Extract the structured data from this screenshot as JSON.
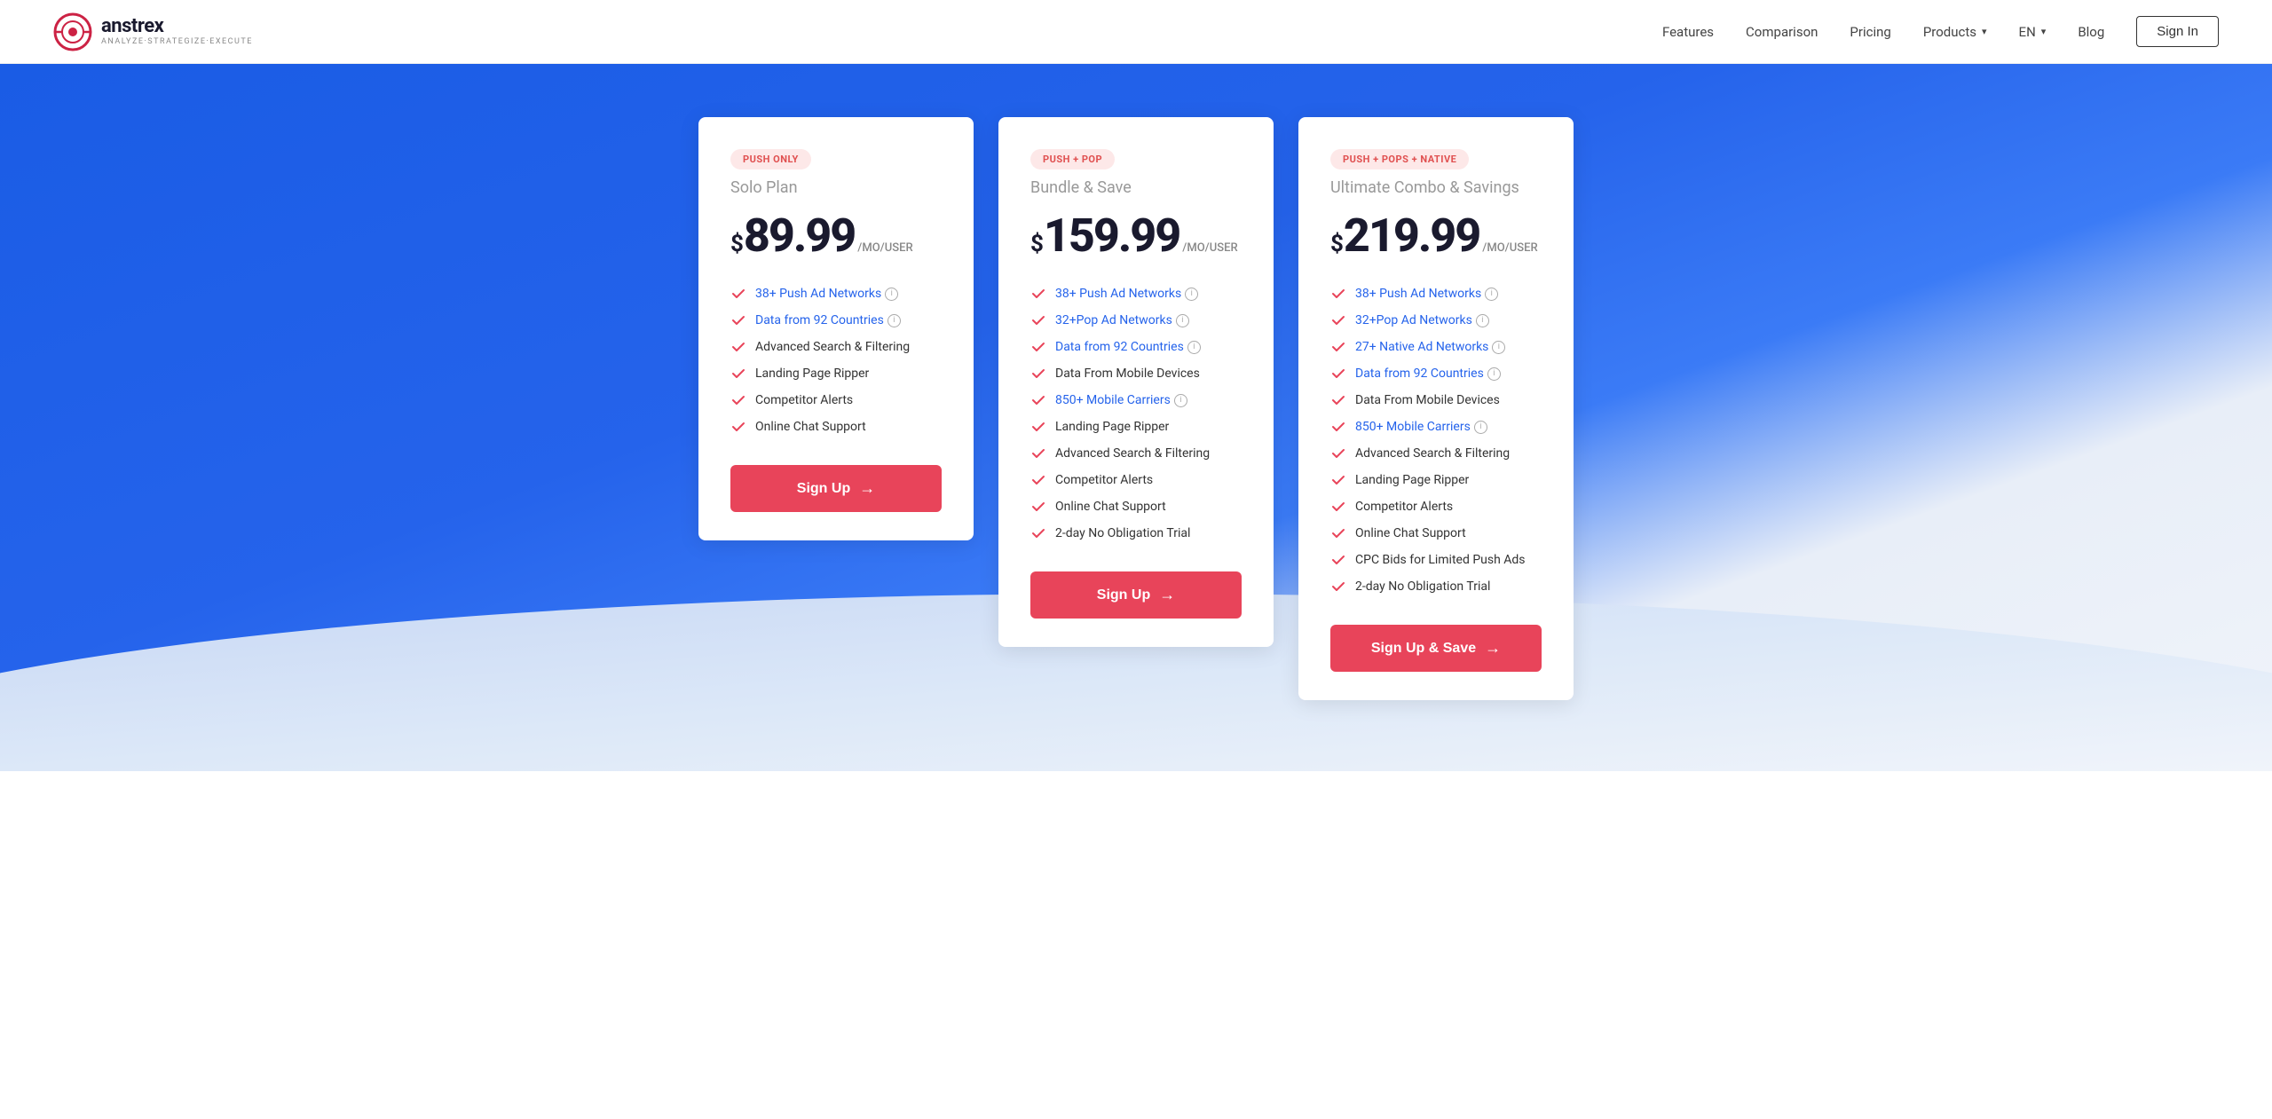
{
  "header": {
    "logo": {
      "main": "anstrex",
      "sub": "Analyze·Strategize·Execute"
    },
    "nav": {
      "features": "Features",
      "comparison": "Comparison",
      "pricing": "Pricing",
      "products": "Products",
      "lang": "EN",
      "blog": "Blog",
      "signin": "Sign In"
    }
  },
  "plans": [
    {
      "badge": "PUSH ONLY",
      "badge_class": "badge-push",
      "name": "Solo Plan",
      "price_dollar": "$",
      "price": "89.99",
      "price_unit": "/MO/USER",
      "features": [
        {
          "text": "38+ Push Ad Networks",
          "link": true,
          "info": true
        },
        {
          "text": "Data from 92 Countries",
          "link": true,
          "info": true
        },
        {
          "text": "Advanced Search & Filtering",
          "link": false,
          "info": false
        },
        {
          "text": "Landing Page Ripper",
          "link": false,
          "info": false
        },
        {
          "text": "Competitor Alerts",
          "link": false,
          "info": false
        },
        {
          "text": "Online Chat Support",
          "link": false,
          "info": false
        }
      ],
      "cta": "Sign Up",
      "cta_key": "plans.0.cta"
    },
    {
      "badge": "PUSH + POP",
      "badge_class": "badge-push-pop",
      "name": "Bundle & Save",
      "price_dollar": "$",
      "price": "159.99",
      "price_unit": "/MO/USER",
      "features": [
        {
          "text": "38+ Push Ad Networks",
          "link": true,
          "info": true
        },
        {
          "text": "32+Pop Ad Networks",
          "link": true,
          "info": true
        },
        {
          "text": "Data from 92 Countries",
          "link": true,
          "info": true
        },
        {
          "text": "Data From Mobile Devices",
          "link": false,
          "info": false
        },
        {
          "text": "850+ Mobile Carriers",
          "link": true,
          "info": true
        },
        {
          "text": "Landing Page Ripper",
          "link": false,
          "info": false
        },
        {
          "text": "Advanced Search & Filtering",
          "link": false,
          "info": false
        },
        {
          "text": "Competitor Alerts",
          "link": false,
          "info": false
        },
        {
          "text": "Online Chat Support",
          "link": false,
          "info": false
        },
        {
          "text": "2-day No Obligation Trial",
          "link": false,
          "info": false
        }
      ],
      "cta": "Sign Up",
      "cta_key": "plans.1.cta"
    },
    {
      "badge": "PUSH + POPS + NATIVE",
      "badge_class": "badge-ultimate",
      "name": "Ultimate Combo & Savings",
      "price_dollar": "$",
      "price": "219.99",
      "price_unit": "/MO/USER",
      "features": [
        {
          "text": "38+ Push Ad Networks",
          "link": true,
          "info": true
        },
        {
          "text": "32+Pop Ad Networks",
          "link": true,
          "info": true
        },
        {
          "text": "27+ Native Ad Networks",
          "link": true,
          "info": true
        },
        {
          "text": "Data from 92 Countries",
          "link": true,
          "info": true
        },
        {
          "text": "Data From Mobile Devices",
          "link": false,
          "info": false
        },
        {
          "text": "850+ Mobile Carriers",
          "link": true,
          "info": true
        },
        {
          "text": "Advanced Search & Filtering",
          "link": false,
          "info": false
        },
        {
          "text": "Landing Page Ripper",
          "link": false,
          "info": false
        },
        {
          "text": "Competitor Alerts",
          "link": false,
          "info": false
        },
        {
          "text": "Online Chat Support",
          "link": false,
          "info": false
        },
        {
          "text": "CPC Bids for Limited Push Ads",
          "link": false,
          "info": false
        },
        {
          "text": "2-day No Obligation Trial",
          "link": false,
          "info": false
        }
      ],
      "cta": "Sign Up & Save",
      "cta_key": "plans.2.cta"
    }
  ]
}
